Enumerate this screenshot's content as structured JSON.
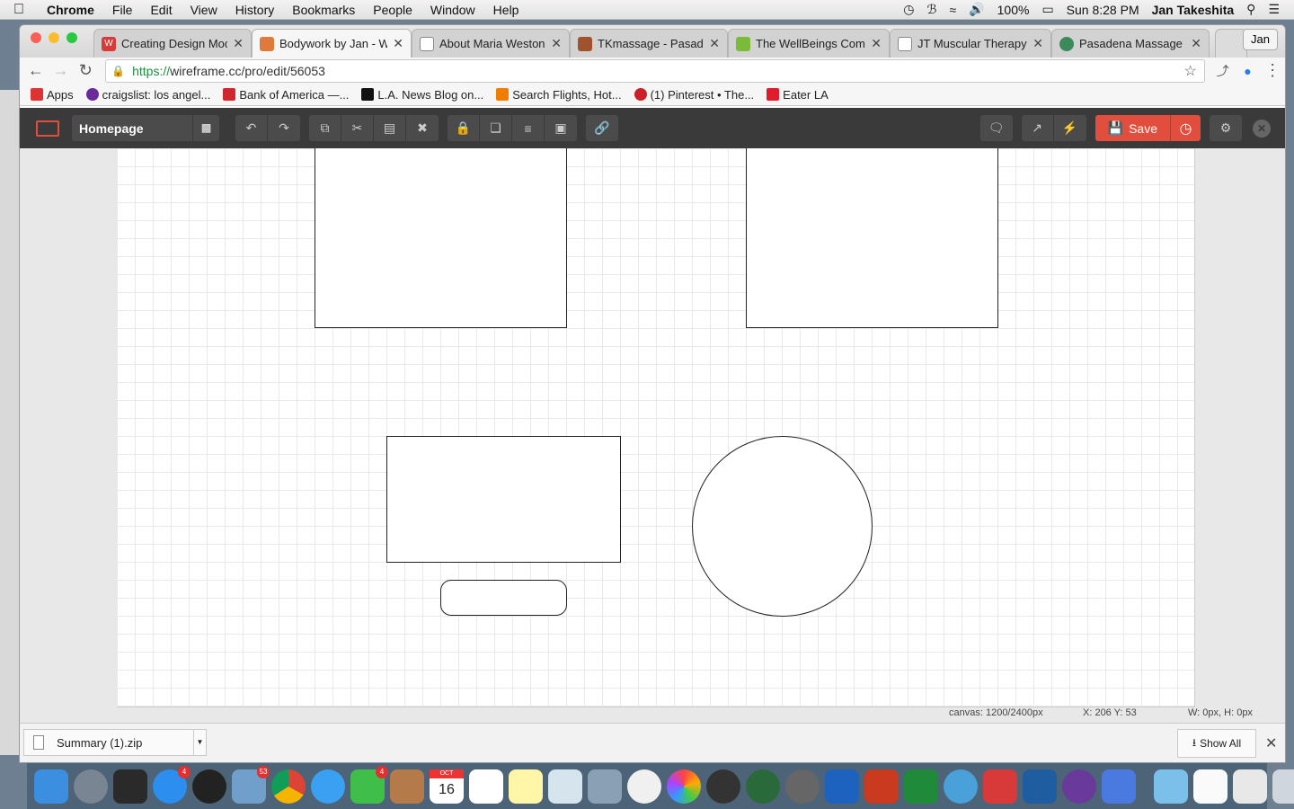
{
  "menubar": {
    "app": "Chrome",
    "items": [
      "File",
      "Edit",
      "View",
      "History",
      "Bookmarks",
      "People",
      "Window",
      "Help"
    ],
    "battery": "100%",
    "clock": "Sun 8:28 PM",
    "user": "Jan Takeshita"
  },
  "browser": {
    "tabs": [
      {
        "title": "Creating Design Mock",
        "color": "#d83a3a"
      },
      {
        "title": "Bodywork by Jan - W",
        "color": "#e07a3a"
      },
      {
        "title": "About Maria Weston C",
        "color": "#888888"
      },
      {
        "title": "TKmassage - Pasadena",
        "color": "#a0522d"
      },
      {
        "title": "The WellBeings Comp",
        "color": "#7cbb3a"
      },
      {
        "title": "JT Muscular Therapy",
        "color": "#888888"
      },
      {
        "title": "Pasadena Massage C",
        "color": "#3a8a5a"
      }
    ],
    "profile": "Jan",
    "url_scheme": "https://",
    "url_rest": "wireframe.cc/pro/edit/56053",
    "bookmarks": [
      {
        "label": "Apps",
        "color": "#d33"
      },
      {
        "label": "craigslist: los angel...",
        "color": "#6a2a9a"
      },
      {
        "label": "Bank of America —...",
        "color": "#d0262d"
      },
      {
        "label": "L.A. News Blog on...",
        "color": "#111111"
      },
      {
        "label": "Search Flights, Hot...",
        "color": "#f07d00"
      },
      {
        "label": "(1) Pinterest • The...",
        "color": "#cb2027"
      },
      {
        "label": "Eater LA",
        "color": "#e01b2b"
      }
    ]
  },
  "app": {
    "page_name": "Homepage",
    "save_label": "Save",
    "icons": {
      "logo": "window-icon",
      "sitemap": "sitemap-icon",
      "undo": "undo-icon",
      "redo": "redo-icon",
      "copy": "copy-icon",
      "cut": "cut-icon",
      "paste": "paste-icon",
      "delete": "delete-icon",
      "lock": "lock-icon",
      "bring": "arrange-icon",
      "align": "align-icon",
      "group": "group-icon",
      "link": "link-icon",
      "comment": "comment-icon",
      "preview": "external-link-icon",
      "flash": "lightning-icon",
      "history": "clock-icon",
      "settings": "settings-icon",
      "close": "close-icon"
    },
    "accent": "#e14e3d"
  },
  "status": {
    "canvas": "canvas: 1200/2400px",
    "cursor": "X: 206 Y: 53",
    "size": "W: 0px, H: 0px"
  },
  "downloads": {
    "file": "Summary (1).zip",
    "show_all": "Show All"
  },
  "dock": {
    "badges": {
      "appstore": "4",
      "mail": "53",
      "facetime": "4"
    },
    "calendar_month": "OCT",
    "calendar_day": "16"
  }
}
